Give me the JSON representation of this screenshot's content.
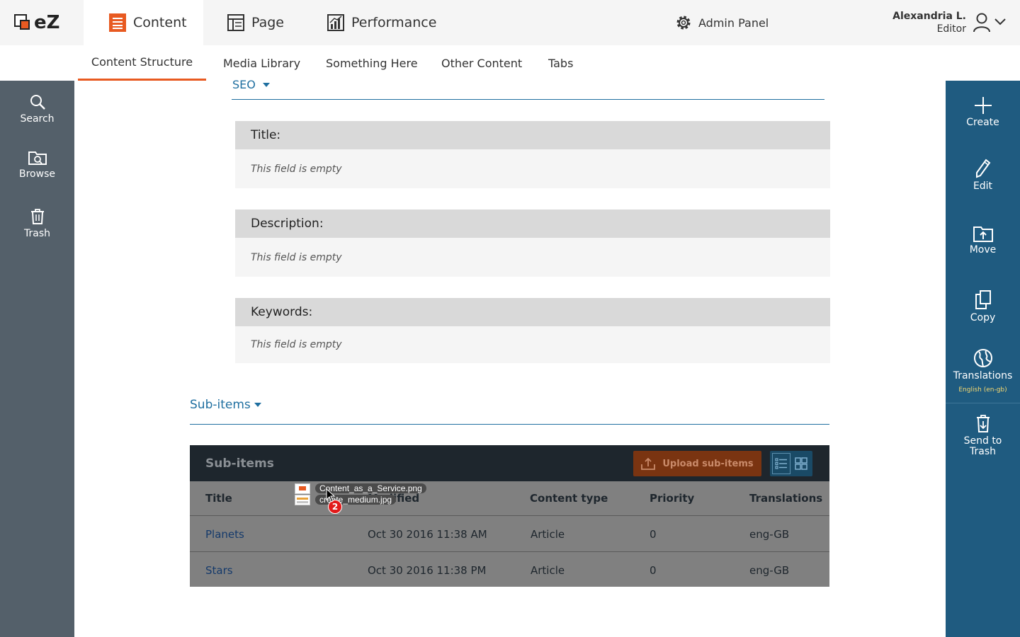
{
  "logo": {
    "text": "eZ"
  },
  "top_nav": {
    "items": [
      {
        "label": "Content",
        "icon": "content-icon",
        "active": true
      },
      {
        "label": "Page",
        "icon": "page-icon",
        "active": false
      },
      {
        "label": "Performance",
        "icon": "performance-icon",
        "active": false
      }
    ],
    "admin_label": "Admin Panel"
  },
  "user": {
    "name": "Alexandria L.",
    "role": "Editor"
  },
  "sub_nav": {
    "items": [
      {
        "label": "Content Structure",
        "active": true
      },
      {
        "label": "Media Library"
      },
      {
        "label": "Something Here"
      },
      {
        "label": "Other Content"
      },
      {
        "label": "Tabs"
      }
    ]
  },
  "left_sidebar": {
    "items": [
      {
        "label": "Search",
        "icon": "search-icon"
      },
      {
        "label": "Browse",
        "icon": "browse-icon"
      },
      {
        "label": "Trash",
        "icon": "trash-icon"
      }
    ]
  },
  "right_sidebar": {
    "items": [
      {
        "label": "Create",
        "icon": "plus-icon"
      },
      {
        "label": "Edit",
        "icon": "pencil-icon"
      },
      {
        "label": "Move",
        "icon": "move-icon"
      },
      {
        "label": "Copy",
        "icon": "copy-icon"
      },
      {
        "label": "Translations",
        "icon": "globe-icon",
        "sub": "English (en-gb)"
      },
      {
        "label": "Send to Trash",
        "icon": "trash-arrow-icon"
      }
    ]
  },
  "seo": {
    "title": "SEO",
    "fields": [
      {
        "label": "Title:",
        "value": "This field is empty"
      },
      {
        "label": "Description:",
        "value": "This field is empty"
      },
      {
        "label": "Keywords:",
        "value": "This field is empty"
      }
    ]
  },
  "subitems": {
    "section_title": "Sub-items",
    "panel_title": "Sub-items",
    "upload_label": "Upload sub-items",
    "columns": [
      "Title",
      "Modified",
      "Content type",
      "Priority",
      "Translations"
    ],
    "rows": [
      {
        "title": "Planets",
        "modified": "Oct 30 2016 11:38 AM",
        "type": "Article",
        "priority": "0",
        "translations": "eng-GB"
      },
      {
        "title": "Stars",
        "modified": "Oct 30 2016 11:38 PM",
        "type": "Article",
        "priority": "0",
        "translations": "eng-GB"
      }
    ]
  },
  "drag": {
    "files": [
      "Content_as_a_Service.png",
      "create_medium.jpg"
    ],
    "count": "2"
  },
  "colors": {
    "accent": "#e85a21",
    "primary": "#1f5b80",
    "link": "#1f6fa0"
  }
}
